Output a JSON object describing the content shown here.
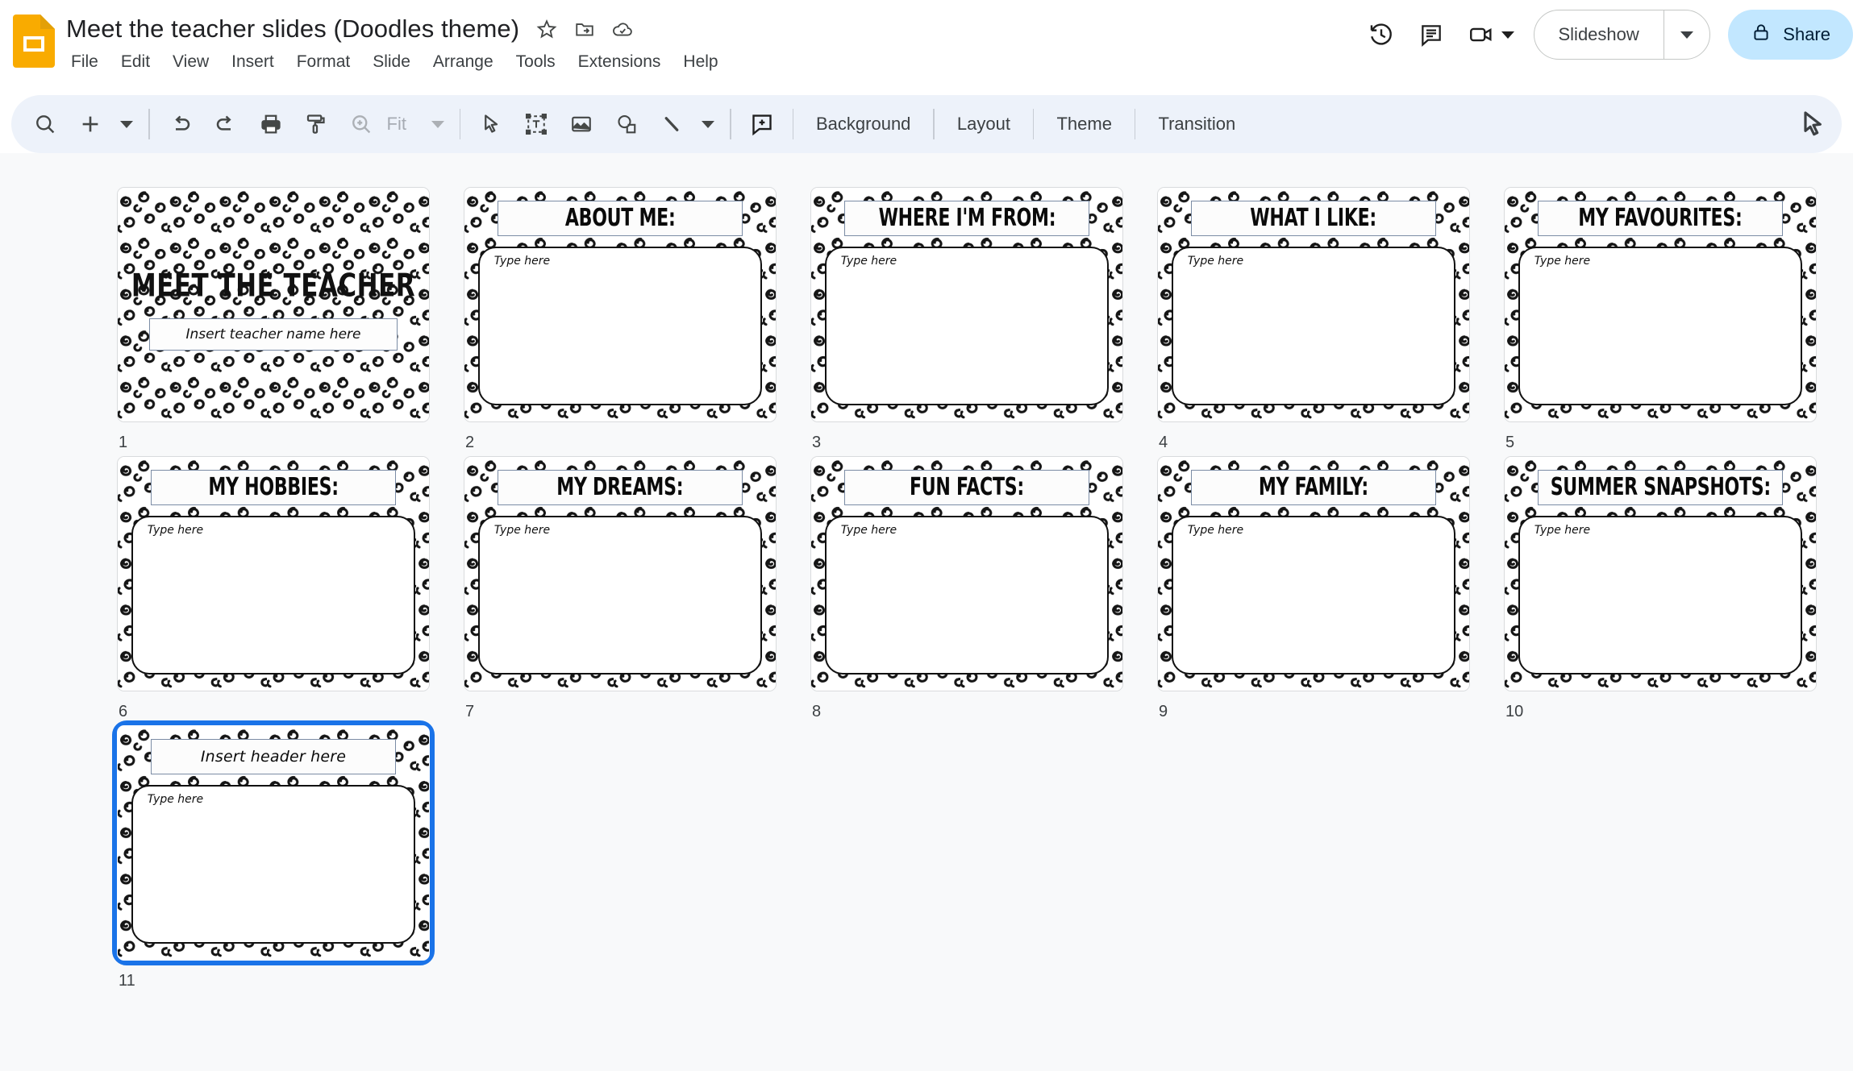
{
  "app": {
    "logo_icon": "google-slides-logo",
    "doc_title": "Meet the teacher slides (Doodles theme)",
    "title_icons": [
      "star-icon",
      "move-to-folder-icon",
      "cloud-saved-icon"
    ]
  },
  "menubar": {
    "items": [
      {
        "label": "File"
      },
      {
        "label": "Edit"
      },
      {
        "label": "View"
      },
      {
        "label": "Insert"
      },
      {
        "label": "Format"
      },
      {
        "label": "Slide"
      },
      {
        "label": "Arrange"
      },
      {
        "label": "Tools"
      },
      {
        "label": "Extensions"
      },
      {
        "label": "Help"
      }
    ]
  },
  "header_right": {
    "history_icon": "version-history-icon",
    "comment_icon": "comment-icon",
    "meet_icon": "video-camera-icon",
    "slideshow_label": "Slideshow",
    "share_label": "Share",
    "share_lock_icon": "lock-icon",
    "share_bg": "#c2e7ff"
  },
  "toolbar": {
    "search_icon": "search-icon",
    "new_slide_icon": "plus-icon",
    "undo_icon": "undo-icon",
    "redo_icon": "redo-icon",
    "print_icon": "print-icon",
    "paint_format_icon": "paint-format-icon",
    "zoom_icon": "zoom-icon",
    "zoom_level": "Fit",
    "select_icon": "cursor-select-icon",
    "textbox_icon": "text-box-icon",
    "image_icon": "image-icon",
    "shape_icon": "shape-icon",
    "line_icon": "line-icon",
    "comment_add_icon": "add-comment-icon",
    "background_label": "Background",
    "layout_label": "Layout",
    "theme_label": "Theme",
    "transition_label": "Transition",
    "bg_color": "#edf2fa"
  },
  "filmstrip": {
    "selected_index": 10,
    "selection_color": "#1a73e8",
    "slides": [
      {
        "number": "1",
        "kind": "title",
        "title": "MEET THE TEACHER",
        "subtitle": "Insert teacher name here"
      },
      {
        "number": "2",
        "kind": "content",
        "header": "ABOUT ME:",
        "body_placeholder": "Type here",
        "handwritten": false
      },
      {
        "number": "3",
        "kind": "content",
        "header": "WHERE I'M FROM:",
        "body_placeholder": "Type here",
        "handwritten": false
      },
      {
        "number": "4",
        "kind": "content",
        "header": "WHAT I LIKE:",
        "body_placeholder": "Type here",
        "handwritten": false
      },
      {
        "number": "5",
        "kind": "content",
        "header": "MY FAVOURITES:",
        "body_placeholder": "Type here",
        "handwritten": false
      },
      {
        "number": "6",
        "kind": "content",
        "header": "MY HOBBIES:",
        "body_placeholder": "Type here",
        "handwritten": false
      },
      {
        "number": "7",
        "kind": "content",
        "header": "MY DREAMS:",
        "body_placeholder": "Type here",
        "handwritten": false
      },
      {
        "number": "8",
        "kind": "content",
        "header": "FUN FACTS:",
        "body_placeholder": "Type here",
        "handwritten": false
      },
      {
        "number": "9",
        "kind": "content",
        "header": "MY FAMILY:",
        "body_placeholder": "Type here",
        "handwritten": false
      },
      {
        "number": "10",
        "kind": "content",
        "header": "SUMMER SNAPSHOTS:",
        "body_placeholder": "Type here",
        "handwritten": false
      },
      {
        "number": "11",
        "kind": "content",
        "header": "Insert header here",
        "body_placeholder": "Type here",
        "handwritten": true
      }
    ]
  }
}
